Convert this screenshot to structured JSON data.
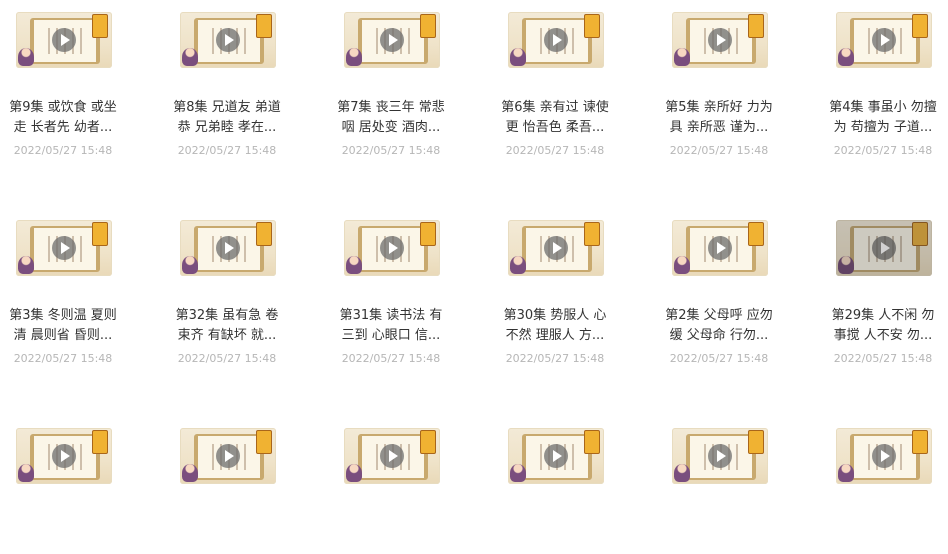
{
  "items": [
    {
      "title_line1": "第9集 或饮食 或坐",
      "title_line2": "走 长者先 幼者...",
      "date": "2022/05/27 15:48"
    },
    {
      "title_line1": "第8集 兄道友 弟道",
      "title_line2": "恭 兄弟睦 孝在...",
      "date": "2022/05/27 15:48"
    },
    {
      "title_line1": "第7集 丧三年 常悲",
      "title_line2": "咽 居处变 酒肉...",
      "date": "2022/05/27 15:48"
    },
    {
      "title_line1": "第6集 亲有过 谏使",
      "title_line2": "更 怡吾色 柔吾...",
      "date": "2022/05/27 15:48"
    },
    {
      "title_line1": "第5集 亲所好 力为",
      "title_line2": "具 亲所恶 谨为...",
      "date": "2022/05/27 15:48"
    },
    {
      "title_line1": "第4集 事虽小 勿擅",
      "title_line2": "为 苟擅为 子道...",
      "date": "2022/05/27 15:48"
    },
    {
      "title_line1": "第3集 冬则温 夏则",
      "title_line2": "清 晨则省 昏则...",
      "date": "2022/05/27 15:48"
    },
    {
      "title_line1": "第32集 虽有急 卷",
      "title_line2": "束齐 有缺坏 就...",
      "date": "2022/05/27 15:48"
    },
    {
      "title_line1": "第31集 读书法 有",
      "title_line2": "三到 心眼口 信...",
      "date": "2022/05/27 15:48"
    },
    {
      "title_line1": "第30集 势服人 心",
      "title_line2": "不然 理服人 方...",
      "date": "2022/05/27 15:48"
    },
    {
      "title_line1": "第2集 父母呼 应勿",
      "title_line2": "缓 父母命 行勿...",
      "date": "2022/05/27 15:48"
    },
    {
      "title_line1": "第29集 人不闲 勿",
      "title_line2": "事搅 人不安 勿...",
      "date": "2022/05/27 15:48"
    },
    {
      "title_line1": "",
      "title_line2": "",
      "date": ""
    },
    {
      "title_line1": "",
      "title_line2": "",
      "date": ""
    },
    {
      "title_line1": "",
      "title_line2": "",
      "date": ""
    },
    {
      "title_line1": "",
      "title_line2": "",
      "date": ""
    },
    {
      "title_line1": "",
      "title_line2": "",
      "date": ""
    },
    {
      "title_line1": "",
      "title_line2": "",
      "date": ""
    }
  ],
  "colors": {
    "accent_thumb_tag": "#f0b232",
    "date_text": "#b6b6b6",
    "title_text": "#333333"
  },
  "icons": {
    "play": "play-icon",
    "thumbnail": "video-thumbnail"
  }
}
